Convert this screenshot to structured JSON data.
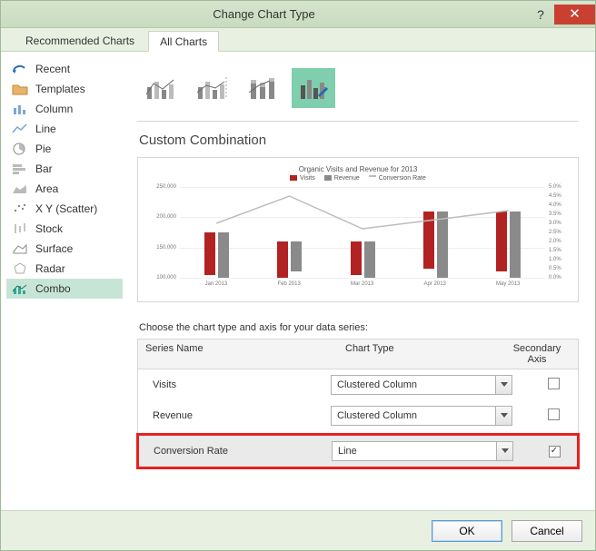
{
  "title": "Change Chart Type",
  "tabs": {
    "recommended": "Recommended Charts",
    "all": "All Charts"
  },
  "sidebar": {
    "items": [
      {
        "label": "Recent"
      },
      {
        "label": "Templates"
      },
      {
        "label": "Column"
      },
      {
        "label": "Line"
      },
      {
        "label": "Pie"
      },
      {
        "label": "Bar"
      },
      {
        "label": "Area"
      },
      {
        "label": "X Y (Scatter)"
      },
      {
        "label": "Stock"
      },
      {
        "label": "Surface"
      },
      {
        "label": "Radar"
      },
      {
        "label": "Combo"
      }
    ]
  },
  "section_title": "Custom Combination",
  "series_instruction": "Choose the chart type and axis for your data series:",
  "series_table": {
    "headers": {
      "name": "Series Name",
      "type": "Chart Type",
      "axis": "Secondary Axis"
    },
    "rows": [
      {
        "name": "Visits",
        "type": "Clustered Column",
        "secondary": false,
        "color": "#b22222"
      },
      {
        "name": "Revenue",
        "type": "Clustered Column",
        "secondary": false,
        "color": "#8a8a8a"
      },
      {
        "name": "Conversion Rate",
        "type": "Line",
        "secondary": true,
        "color": "#bdbdbd"
      }
    ]
  },
  "buttons": {
    "ok": "OK",
    "cancel": "Cancel"
  },
  "chart_data": {
    "type": "bar",
    "title": "Organic Visits and Revenue for 2013",
    "categories": [
      "Jan 2013",
      "Feb 2013",
      "Mar 2013",
      "Apr 2013",
      "May 2013"
    ],
    "ylabel_left": "",
    "ylabel_right": "",
    "ylim_left": [
      100000,
      250000
    ],
    "ylim_right": [
      0.0,
      5.0
    ],
    "y_left_ticks": [
      "250,000",
      "200,000",
      "150,000",
      "100,000"
    ],
    "y_right_ticks": [
      "5.0%",
      "4.5%",
      "4.0%",
      "3.5%",
      "3.0%",
      "2.5%",
      "2.0%",
      "1.5%",
      "1.0%",
      "0.5%",
      "0.0%"
    ],
    "series": [
      {
        "name": "Visits",
        "type": "bar",
        "color": "#b22222",
        "values": [
          170000,
          160000,
          155000,
          195000,
          200000
        ]
      },
      {
        "name": "Revenue",
        "type": "bar",
        "color": "#8a8a8a",
        "values": [
          175000,
          150000,
          160000,
          210000,
          210000
        ]
      },
      {
        "name": "Conversion Rate",
        "type": "line",
        "color": "#bdbdbd",
        "values": [
          3.0,
          4.5,
          2.7,
          3.2,
          3.7
        ]
      }
    ],
    "legend": [
      "Visits",
      "Revenue",
      "Conversion Rate"
    ]
  }
}
